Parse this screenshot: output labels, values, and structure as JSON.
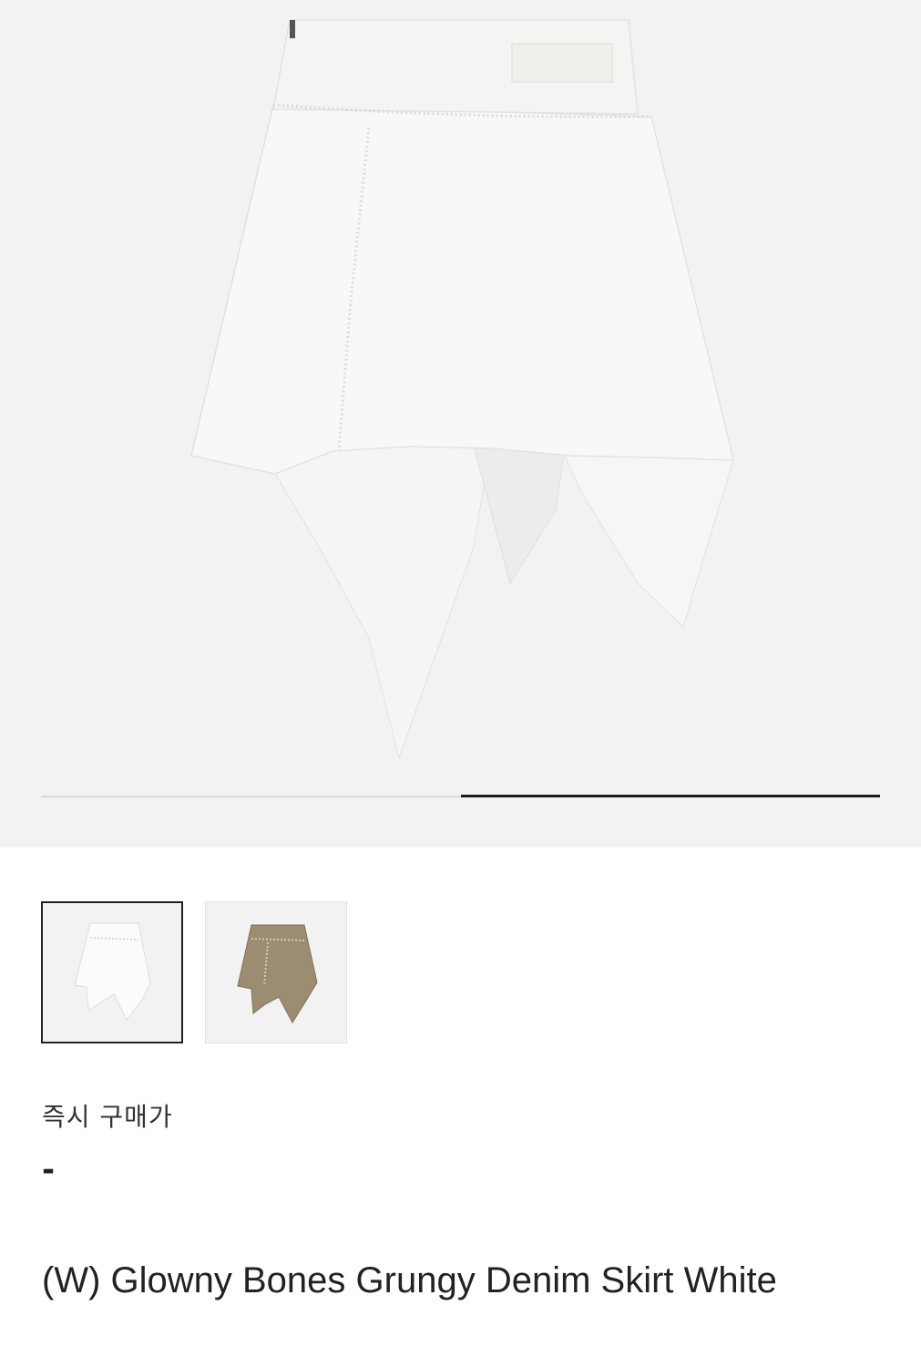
{
  "gallery": {
    "current_slide_fraction": 0.5,
    "thumbnails": [
      {
        "name": "white-skirt-thumbnail",
        "color": "#f7f7f5",
        "selected": true
      },
      {
        "name": "beige-skirt-thumbnail",
        "color": "#9c8c72",
        "selected": false
      }
    ]
  },
  "price": {
    "label": "즉시 구매가",
    "value": "-"
  },
  "product": {
    "name": "(W) Glowny Bones Grungy Denim Skirt White"
  },
  "colors": {
    "background": "#f2f2f2",
    "accent": "#1c1c1c"
  }
}
